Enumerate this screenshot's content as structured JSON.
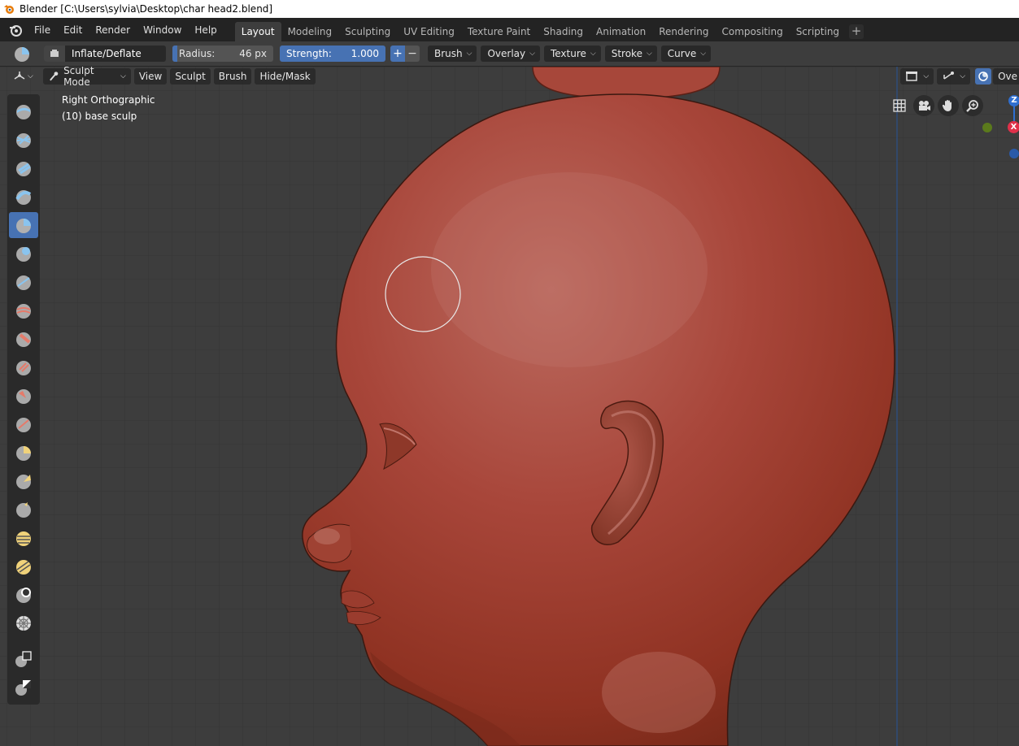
{
  "window": {
    "title": "Blender [C:\\Users\\sylvia\\Desktop\\char head2.blend]"
  },
  "menu": {
    "items": [
      "File",
      "Edit",
      "Render",
      "Window",
      "Help"
    ]
  },
  "workspaces": {
    "tabs": [
      "Layout",
      "Modeling",
      "Sculpting",
      "UV Editing",
      "Texture Paint",
      "Shading",
      "Animation",
      "Rendering",
      "Compositing",
      "Scripting"
    ],
    "active": "Layout"
  },
  "tool_settings": {
    "brush_name": "Inflate/Deflate",
    "radius_label": "Radius:",
    "radius_value": "46 px",
    "strength_label": "Strength:",
    "strength_value": "1.000",
    "plus": "+",
    "minus": "−",
    "dropdowns": [
      "Brush",
      "Overlay",
      "Texture",
      "Stroke",
      "Curve"
    ]
  },
  "viewport": {
    "mode": "Sculpt Mode",
    "menus": [
      "View",
      "Sculpt",
      "Brush",
      "Hide/Mask"
    ],
    "view_name": "Right Orthographic",
    "object_info": "(10) base sculp",
    "overlays_label": "Ove",
    "gizmo": {
      "z": "Z",
      "x": "X"
    }
  },
  "colors": {
    "accent": "#4772b3",
    "skin": "#a43c2e",
    "background": "#3d3d3d"
  },
  "toolbar_tools": [
    "draw",
    "draw-sharp",
    "clay",
    "clay-strips",
    "inflate",
    "blob",
    "crease",
    "smooth",
    "flatten",
    "fill",
    "scrape",
    "pinch",
    "grab",
    "snake-hook",
    "thumb",
    "rotate",
    "simplify",
    "mask",
    "box-mask",
    "lasso-mask",
    "transform"
  ]
}
